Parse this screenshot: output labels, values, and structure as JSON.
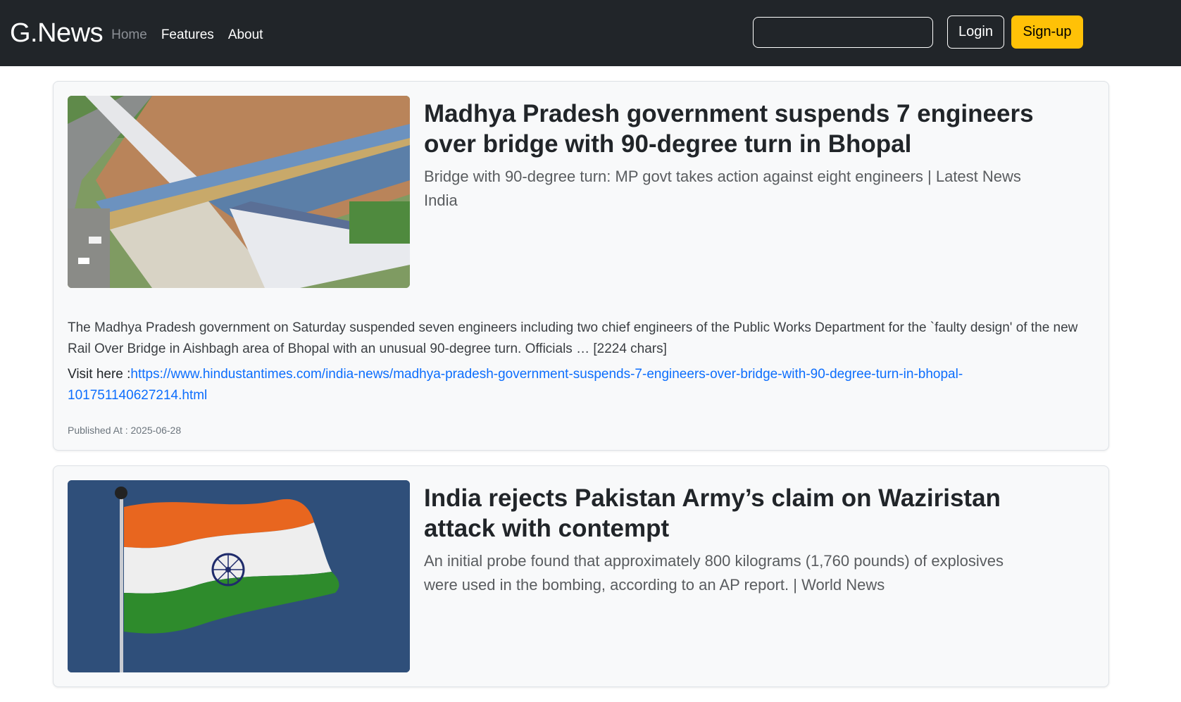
{
  "navbar": {
    "brand": "G.News",
    "links": [
      "Home",
      "Features",
      "About"
    ],
    "search_value": "",
    "login_label": "Login",
    "signup_label": "Sign-up"
  },
  "articles": [
    {
      "headline": "Madhya Pradesh government suspends 7 engineers over bridge with 90-degree turn in Bhopal",
      "subhead": "Bridge with 90-degree turn: MP govt takes action against eight engineers | Latest News India",
      "description": "The Madhya Pradesh government on Saturday suspended seven engineers including two chief engineers of the Public Works Department for the `faulty design' of the new Rail Over Bridge in Aishbagh area of Bhopal with an unusual 90-degree turn. Officials … [2224 chars]",
      "visit_prefix": "Visit here :",
      "url": "https://www.hindustantimes.com/india-news/madhya-pradesh-government-suspends-7-engineers-over-bridge-with-90-degree-turn-in-bhopal-101751140627214.html",
      "published": "Published At : 2025-06-28"
    },
    {
      "headline": "India rejects Pakistan Army’s claim on Waziristan attack with contempt",
      "subhead": "An initial probe found that approximately 800 kilograms (1,760 pounds) of explosives were used in the bombing, according to an AP report.  | World News"
    }
  ],
  "colors": {
    "navbar_bg": "#212529",
    "signup_bg": "#ffc107",
    "link": "#0d6efd",
    "card_bg": "#f8f9fa"
  }
}
